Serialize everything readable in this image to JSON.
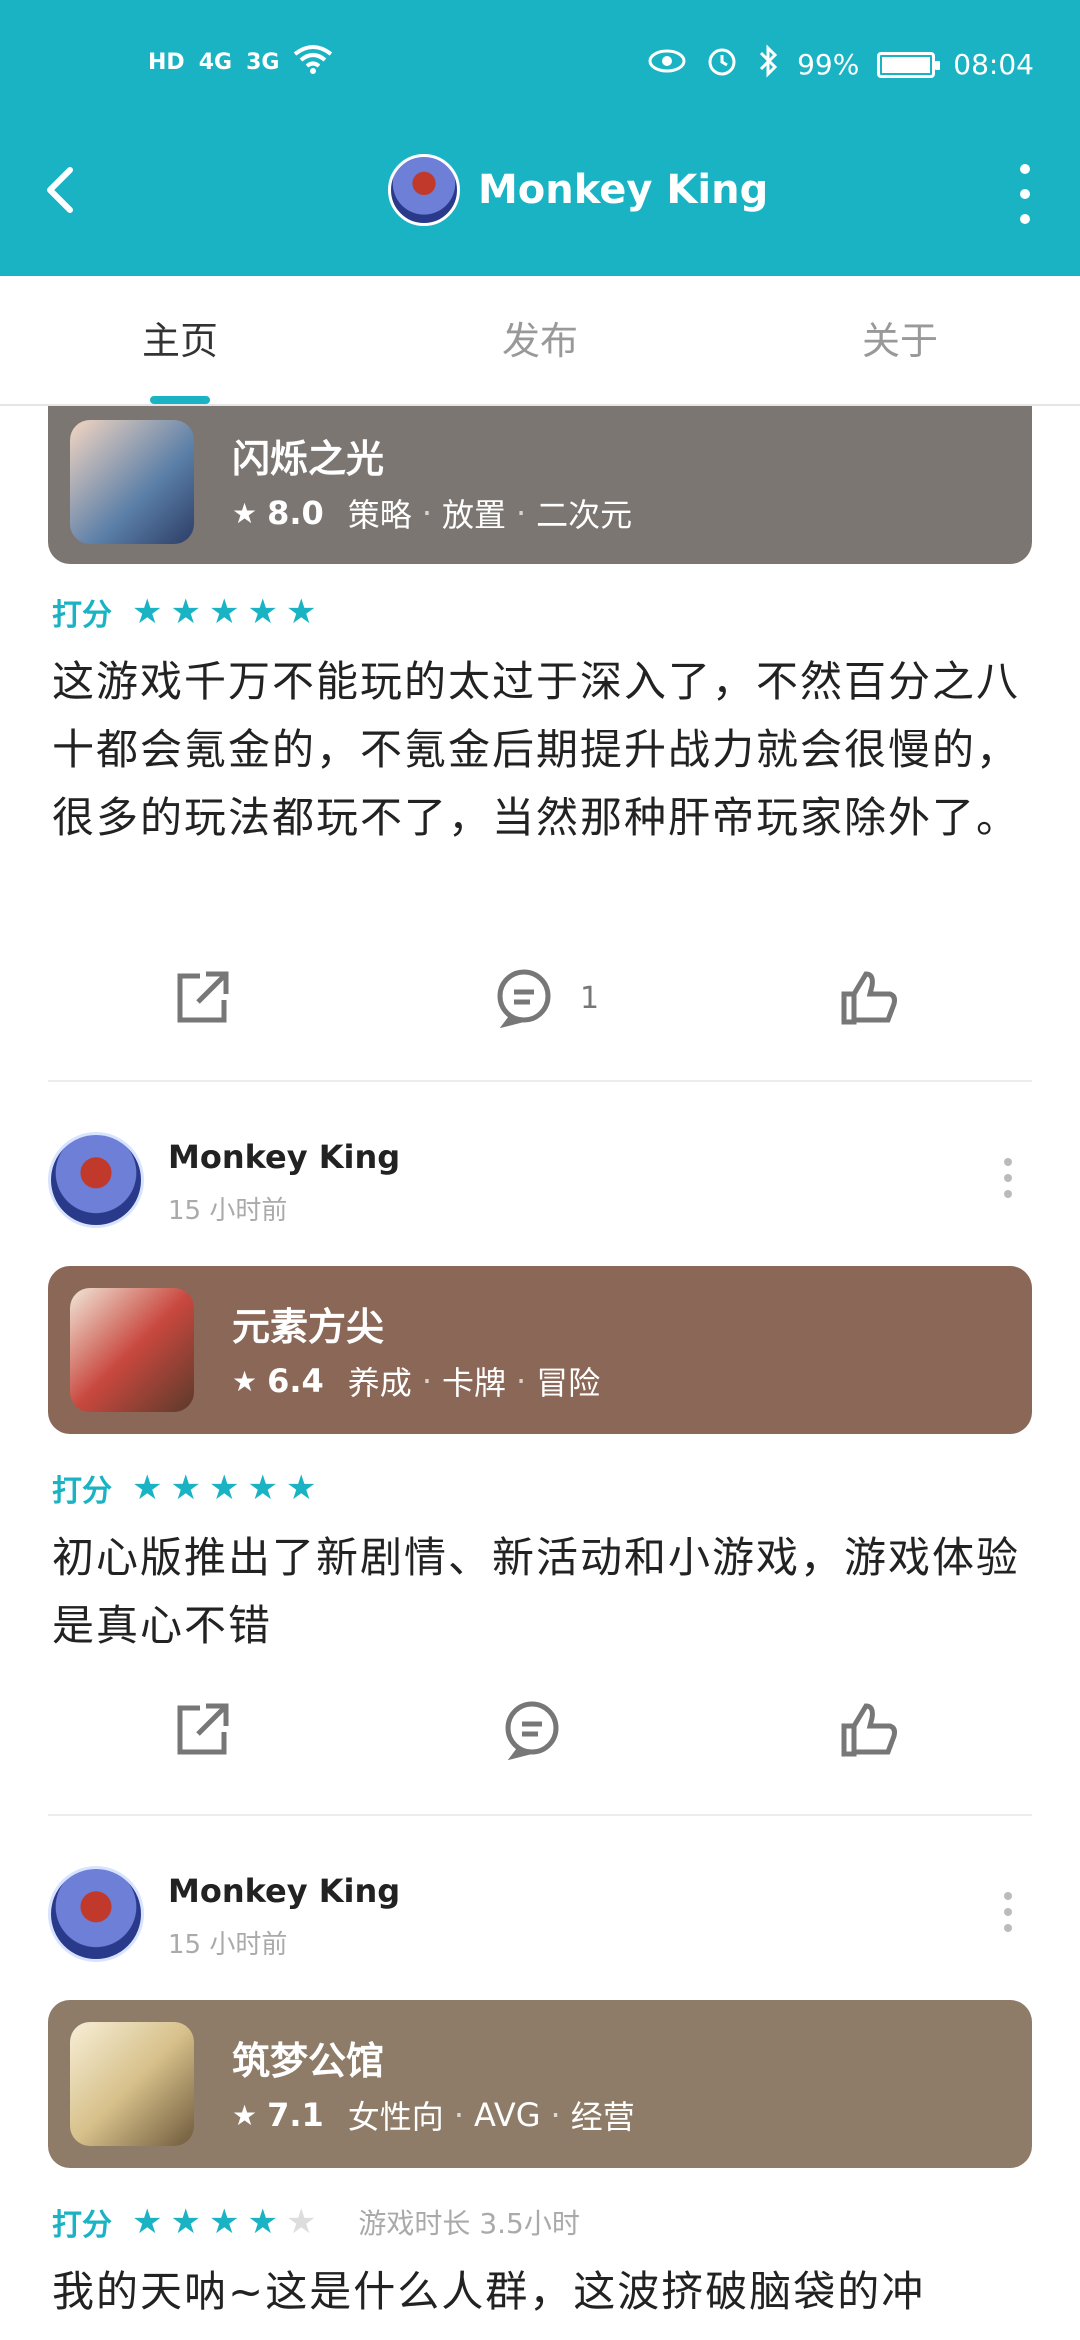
{
  "status_bar": {
    "left_icons": [
      "HD",
      "4G",
      "3G"
    ],
    "battery": "99%",
    "battery_level": 0.99,
    "time": "08:04"
  },
  "app_bar": {
    "back_icon": "back-icon",
    "title": "Monkey King",
    "more_icon": "more-vertical-icon"
  },
  "tabs": [
    {
      "label": "主页",
      "active": true
    },
    {
      "label": "发布",
      "active": false
    },
    {
      "label": "关于",
      "active": false
    }
  ],
  "posts": [
    {
      "game": {
        "name": "闪烁之光",
        "score": "8.0",
        "tags": [
          "策略",
          "放置",
          "二次元"
        ],
        "color": "#7c7673"
      },
      "rating_label": "打分",
      "stars": 5,
      "review": "这游戏千万不能玩的太过于深入了，不然百分之八十都会氪金的，不氪金后期提升战力就会很慢的，很多的玩法都玩不了，当然那种肝帝玩家除外了。",
      "comment_count": "1"
    },
    {
      "user": {
        "name": "Monkey King",
        "time": "15 小时前"
      },
      "game": {
        "name": "元素方尖",
        "score": "6.4",
        "tags": [
          "养成",
          "卡牌",
          "冒险"
        ],
        "color": "#8a6756"
      },
      "rating_label": "打分",
      "stars": 5,
      "review": "初心版推出了新剧情、新活动和小游戏，游戏体验是真心不错",
      "comment_count": ""
    },
    {
      "user": {
        "name": "Monkey King",
        "time": "15 小时前"
      },
      "game": {
        "name": "筑梦公馆",
        "score": "7.1",
        "tags": [
          "女性向",
          "AVG",
          "经营"
        ],
        "color": "#8e7c68"
      },
      "rating_label": "打分",
      "stars": 4,
      "playtime": "游戏时长 3.5小时",
      "review": "我的天呐~这是什么人群，这波挤破脑袋的冲"
    }
  ],
  "colors": {
    "accent": "#1ab3c4",
    "text": "#222222",
    "muted": "#aaaaaa"
  }
}
